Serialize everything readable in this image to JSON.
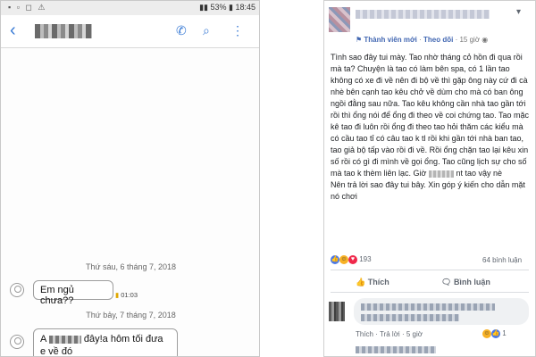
{
  "phone": {
    "status_bar": {
      "notif_icons": "▪ ▫ ◻ ⚠",
      "right": "53% 18:45",
      "battery": "53%",
      "time": "18:45"
    },
    "header": {
      "back_icon": "back-chevron-icon",
      "actions": [
        "phone-icon",
        "search-icon",
        "more-vert-icon"
      ]
    },
    "messages": [
      {
        "type": "date",
        "text": "Thứ sáu, 6 tháng 7, 2018"
      },
      {
        "type": "received",
        "text": "Em ngủ chưa??",
        "time": "01:03"
      },
      {
        "type": "date",
        "text": "Thứ bảy, 7 tháng 7, 2018"
      },
      {
        "type": "received",
        "line1_prefix": "A",
        "line1_suffix": "đây!a hôm tối đưa",
        "line2": "e về đó"
      }
    ]
  },
  "post": {
    "member_badge": "Thành viên mới",
    "follow_label": "Theo dõi",
    "time_ago": "15 giờ",
    "body_part1": "Tình sao đây tui mày. Tao nhờ tháng cỏ hồn đi qua rồi mà ta? Chuyện là tao có làm bên spa, có 1 lần tao không có xe đi về nên đi bộ về thì gặp ông này cứ đi cà nhè bên cạnh tao kêu chở về dùm cho mà có ban ông ngồi đằng sau nữa. Tao kêu không cần nhà tao gần tới rồi thì ổng nói để ổng đi theo về coi chứng tao. Tao mặc kê tao đi luôn rồi ổng đi theo tao hỏi thăm các kiểu mà có cầu tao tỉ có câu tao k tl rồi khi gần tới nhà ban tao, tao giả bộ tấp vào rồi đi về. Rồi ổng chặn tao lại kêu xin số rồi có gì đi mình về gọi ổng. Tao cũng lịch sự cho số mà tao k thèm liên lạc. Giờ",
    "body_part2": "nt tao vậy nè",
    "body_part3": "Nên trả lời sao đây tui bây. Xin góp ý kiến cho dẫn mặt nó chơi",
    "reaction_count": "193",
    "comment_count": "64 bình luận",
    "like_label": "Thích",
    "comment_label": "Bình luận",
    "comment_actions": {
      "like": "Thích",
      "reply": "Trả lời",
      "time": "5 giờ"
    },
    "comment_reaction_count": "1"
  },
  "colors": {
    "accent_blue": "#3a7bd5",
    "fb_blue": "#4267b2"
  }
}
